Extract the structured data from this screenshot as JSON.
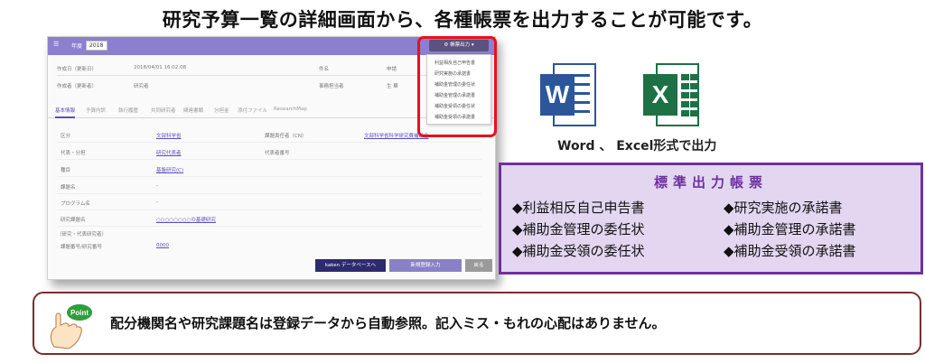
{
  "headline": "研究予算一覧の詳細画面から、各種帳票を出力することが可能です。",
  "screenshot": {
    "bar_year_label": "年度",
    "bar_year_value": "2018",
    "fields_top": [
      "作成日（更新日）",
      "2018/04/01 16:02:08",
      "件名",
      "申請",
      "作成者（更新者）",
      "研究者",
      "事務担当者",
      "生 華"
    ],
    "tabs": [
      "基本情報",
      "予算内訳",
      "執行履歴",
      "共同研究者",
      "関連書類",
      "分担金",
      "添付ファイル",
      "ResearchMap"
    ],
    "rows_left": [
      "区分",
      "代表・分担",
      "種目",
      "課題名",
      "プログラム名",
      "研究課題名",
      "〔研究・代表研究者〕",
      "課題番号/研究番号"
    ],
    "rows_mid": [
      "文部科学省",
      "研究代表者",
      "基盤研究(C)",
      "-",
      "-",
      "○○○○○○○○の基礎研究",
      "",
      "0000"
    ],
    "rows_right": [
      "課題責任者（CN）",
      "代表者番号"
    ],
    "row_right_value": "文部科学省科学研究費補助金",
    "footer_buttons": [
      "kaken データベースへ",
      "新規登録入力",
      "戻る"
    ],
    "export_button": "帳票出力",
    "export_menu": [
      "利益相反自己申告書",
      "研究実施の承諾書",
      "補助金管理の委任状",
      "補助金管理の承諾書",
      "補助金受領の委任状",
      "補助金受領の承諾書"
    ]
  },
  "formats": {
    "word_letter": "W",
    "excel_letter": "X",
    "caption": "Word 、 Excel形式で出力"
  },
  "standard_forms": {
    "title": "標準出力帳票",
    "items_left": [
      "◆利益相反自己申告書",
      "◆補助金管理の委任状",
      "◆補助金受領の委任状"
    ],
    "items_right": [
      "◆研究実施の承諾書",
      "◆補助金管理の承諾書",
      "◆補助金受領の承諾書"
    ]
  },
  "point": {
    "badge": "Point",
    "text": "配分機関名や研究課題名は登録データから自動参照。記入ミス・もれの心配はありません。"
  },
  "colors": {
    "window_bar": "#8c7fd2",
    "popup_outline": "#e8101d",
    "word": "#2b579a",
    "excel": "#1e7145",
    "forms_border": "#7030a0",
    "forms_bg": "#e2d6f0",
    "point_border": "#7b2d2d"
  }
}
